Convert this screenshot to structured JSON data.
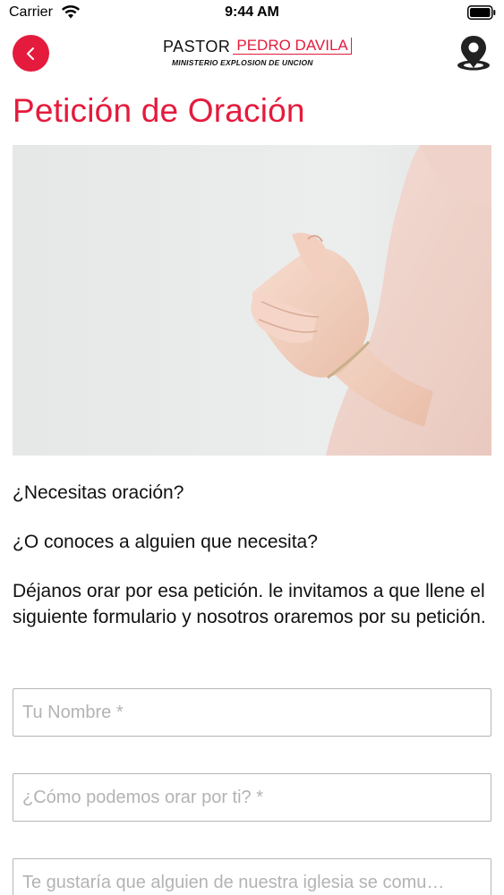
{
  "status_bar": {
    "carrier": "Carrier",
    "time": "9:44 AM",
    "icons": [
      "wifi-icon",
      "battery-icon"
    ]
  },
  "header": {
    "back_icon": "chevron-left-icon",
    "logo": {
      "line1_left": "PASTOR",
      "line1_right": "PEDRO DAVILA",
      "line2": "MINISTERIO EXPLOSION DE UNCION"
    },
    "location_icon": "map-pin-icon"
  },
  "page": {
    "title": "Petición de Oración",
    "hero_image": "praying-hands-photo",
    "paragraphs": [
      "¿Necesitas oración?",
      "¿O conoces a alguien que necesita?",
      "Déjanos orar por esa petición. le invitamos a que llene el siguiente formulario y nosotros oraremos por su petición."
    ]
  },
  "form": {
    "name_placeholder": "Tu Nombre *",
    "prayer_placeholder": "¿Cómo podemos orar por ti? *",
    "contact_placeholder": "Te gustaría que alguien de nuestra iglesia se comu…"
  },
  "colors": {
    "accent": "#e41b3c",
    "text": "#111111",
    "placeholder": "#b3b3b3",
    "field_border": "#b5b5b5"
  }
}
